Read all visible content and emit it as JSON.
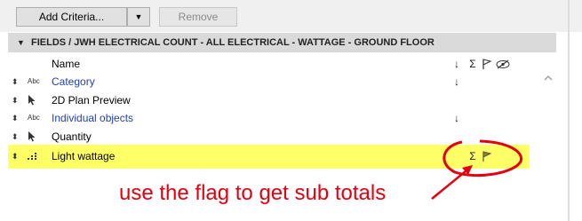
{
  "toolbar": {
    "add_criteria_label": "Add Criteria...",
    "dropdown_arrow": "▼",
    "remove_label": "Remove"
  },
  "section": {
    "arrow": "▼",
    "title": "FIELDS / JWH ELECTRICAL COUNT - ALL ELECTRICAL - WATTAGE - GROUND FLOOR"
  },
  "table": {
    "header": {
      "name": "Name",
      "col_sort": "↓",
      "col_sum": "Σ",
      "col_flag_icon": "flag-icon",
      "col_hide_icon": "eye-hidden-icon"
    },
    "rows": [
      {
        "type_icon": "Abc",
        "label": "Category",
        "sort": "↓",
        "sum": "",
        "flag": false,
        "highlighted": false,
        "blue": true
      },
      {
        "type_icon": "cursor-icon",
        "label": "2D Plan Preview",
        "sort": "",
        "sum": "",
        "flag": false,
        "highlighted": false,
        "blue": false
      },
      {
        "type_icon": "Abc",
        "label": "Individual objects",
        "sort": "↓",
        "sum": "",
        "flag": false,
        "highlighted": false,
        "blue": true
      },
      {
        "type_icon": "cursor-icon",
        "label": "Quantity",
        "sort": "",
        "sum": "",
        "flag": false,
        "highlighted": false,
        "blue": false
      },
      {
        "type_icon": "number-format-icon",
        "label": "Light wattage",
        "sort": "",
        "sum": "Σ",
        "flag": true,
        "highlighted": true,
        "blue": false
      }
    ]
  },
  "annotation": {
    "text": "use the flag to get sub totals",
    "color": "#e3000f"
  },
  "colors": {
    "highlight": "#ffff66",
    "blue_text": "#1f3fb5",
    "annotation_red": "#e3000f"
  }
}
